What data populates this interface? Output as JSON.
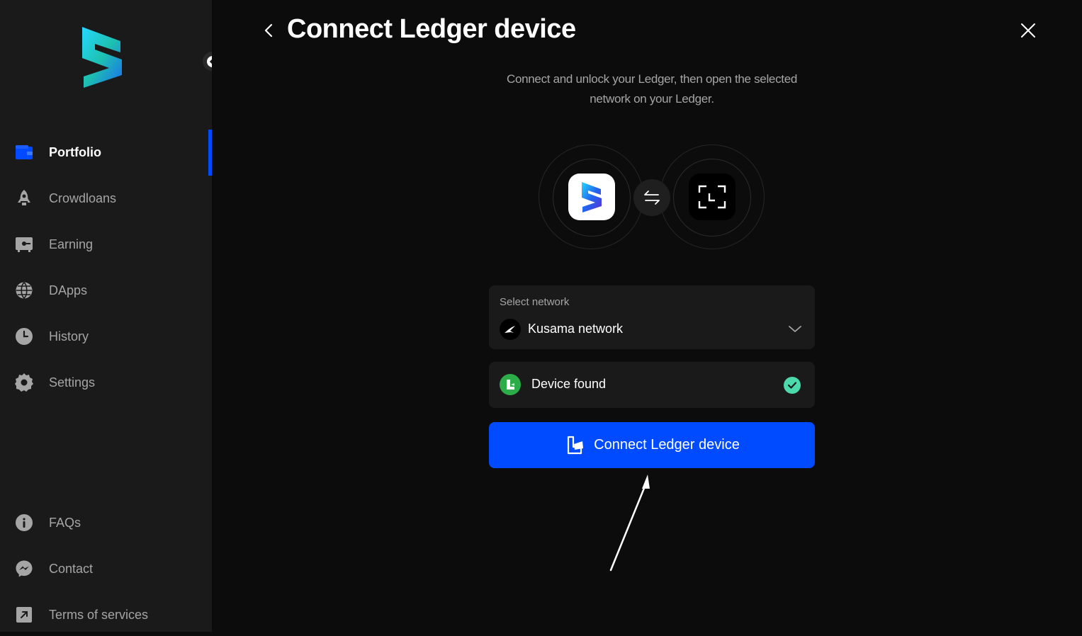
{
  "sidebar": {
    "items": [
      {
        "label": "Portfolio",
        "icon": "wallet-icon",
        "active": true
      },
      {
        "label": "Crowdloans",
        "icon": "rocket-icon",
        "active": false
      },
      {
        "label": "Earning",
        "icon": "safe-icon",
        "active": false
      },
      {
        "label": "DApps",
        "icon": "globe-icon",
        "active": false
      },
      {
        "label": "History",
        "icon": "clock-icon",
        "active": false
      },
      {
        "label": "Settings",
        "icon": "gear-icon",
        "active": false
      }
    ],
    "bottom_items": [
      {
        "label": "FAQs",
        "icon": "info-icon"
      },
      {
        "label": "Contact",
        "icon": "messenger-icon"
      },
      {
        "label": "Terms of services",
        "icon": "external-link-icon"
      }
    ]
  },
  "header": {
    "title": "Connect Ledger device"
  },
  "main": {
    "subtitle": "Connect and unlock your Ledger, then open the selected network on your Ledger.",
    "network_select": {
      "label": "Select network",
      "value": "Kusama network"
    },
    "device_status": {
      "text": "Device found"
    },
    "connect_button": {
      "label": "Connect Ledger device"
    }
  },
  "colors": {
    "accent": "#004bff",
    "success": "#4cd9ac",
    "sidebar_bg": "#1a1a1a",
    "page_bg": "#0c0c0c"
  }
}
